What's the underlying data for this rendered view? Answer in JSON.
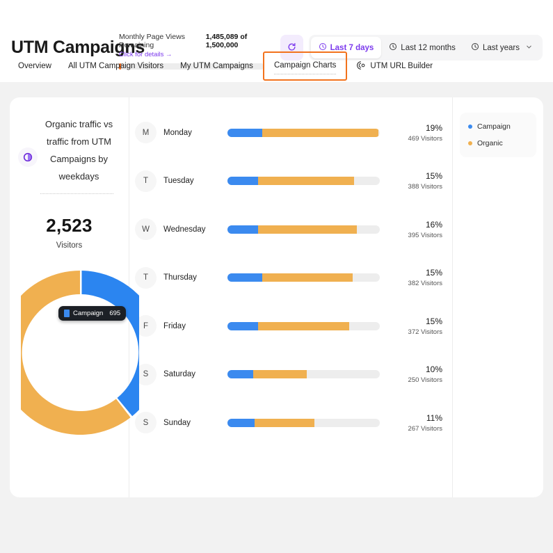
{
  "header": {
    "title": "UTM Campaigns",
    "quota": {
      "label": "Monthly Page Views Remaining",
      "link": "Click for details →",
      "remaining": "1,485,089",
      "of_text": " of ",
      "total": "1,500,000",
      "count_display": "1,485,089 of 1,500,000",
      "used_percent": 1,
      "bar_color": "#f26a1b"
    },
    "controls": {
      "refresh_icon": "refresh-icon",
      "ranges": [
        {
          "label": "Last 7 days",
          "icon": "clock-icon",
          "active": true
        },
        {
          "label": "Last 12 months",
          "icon": "clock-icon",
          "active": false
        },
        {
          "label": "Last years",
          "icon": "clock-icon",
          "active": false
        }
      ],
      "chevron_icon": "chevron-down-icon"
    }
  },
  "tabs": [
    {
      "label": "Overview",
      "selected": false,
      "icon": null
    },
    {
      "label": "All UTM Campaign Visitors",
      "selected": false,
      "icon": null
    },
    {
      "label": "My UTM Campaigns",
      "selected": false,
      "icon": null
    },
    {
      "label": "Campaign Charts",
      "selected": true,
      "icon": null
    },
    {
      "label": "UTM URL Builder",
      "selected": false,
      "icon": "target-link-icon"
    }
  ],
  "panel": {
    "badge_icon": "donut-chart-icon",
    "title": "Organic traffic vs traffic from UTM Campaigns by weekdays",
    "total_value": "2,523",
    "total_label": "Visitors",
    "tooltip": {
      "series": "Campaign",
      "value": "695",
      "swatch_color": "#3b8aef"
    }
  },
  "legend": [
    {
      "label": "Campaign",
      "color": "#3b8aef"
    },
    {
      "label": "Organic",
      "color": "#f0b050"
    }
  ],
  "colors": {
    "campaign": "#3b8aef",
    "organic": "#f0b050",
    "track": "#ededed",
    "accent_purple": "#7c3aed",
    "accent_orange": "#f2721c"
  },
  "chart_data": {
    "type": "bar",
    "title": "Organic traffic vs traffic from UTM Campaigns by weekdays",
    "stacked": true,
    "orientation": "horizontal",
    "total_visitors": 2523,
    "legend": [
      "Campaign",
      "Organic"
    ],
    "legend_position": "right",
    "grid": false,
    "categories": [
      "Monday",
      "Tuesday",
      "Wednesday",
      "Thursday",
      "Friday",
      "Saturday",
      "Sunday"
    ],
    "initials": [
      "M",
      "T",
      "W",
      "T",
      "F",
      "S",
      "S"
    ],
    "values": [
      469,
      388,
      395,
      382,
      372,
      250,
      267
    ],
    "percents": [
      "19%",
      "15%",
      "16%",
      "15%",
      "15%",
      "10%",
      "11%"
    ],
    "visitors_labels": [
      "469 Visitors",
      "388 Visitors",
      "395 Visitors",
      "382 Visitors",
      "372 Visitors",
      "250 Visitors",
      "267 Visitors"
    ],
    "rows": [
      {
        "initial": "M",
        "day": "Monday",
        "percent": "19%",
        "visitors": "469 Visitors",
        "campaign_pct": 23,
        "organic_pct": 76
      },
      {
        "initial": "T",
        "day": "Tuesday",
        "percent": "15%",
        "visitors": "388 Visitors",
        "campaign_pct": 20,
        "organic_pct": 63
      },
      {
        "initial": "W",
        "day": "Wednesday",
        "percent": "16%",
        "visitors": "395 Visitors",
        "campaign_pct": 20,
        "organic_pct": 65
      },
      {
        "initial": "T",
        "day": "Thursday",
        "percent": "15%",
        "visitors": "382 Visitors",
        "campaign_pct": 23,
        "organic_pct": 59
      },
      {
        "initial": "F",
        "day": "Friday",
        "percent": "15%",
        "visitors": "372 Visitors",
        "campaign_pct": 20,
        "organic_pct": 60
      },
      {
        "initial": "S",
        "day": "Saturday",
        "percent": "10%",
        "visitors": "250 Visitors",
        "campaign_pct": 17,
        "organic_pct": 35
      },
      {
        "initial": "S",
        "day": "Sunday",
        "percent": "11%",
        "visitors": "267 Visitors",
        "campaign_pct": 18,
        "organic_pct": 39
      }
    ],
    "donut": {
      "type": "pie",
      "labels": [
        "Campaign",
        "Organic"
      ],
      "values": [
        695,
        1828
      ],
      "colors": [
        "#3b8aef",
        "#f0b050"
      ],
      "center_total": "2,523"
    }
  }
}
